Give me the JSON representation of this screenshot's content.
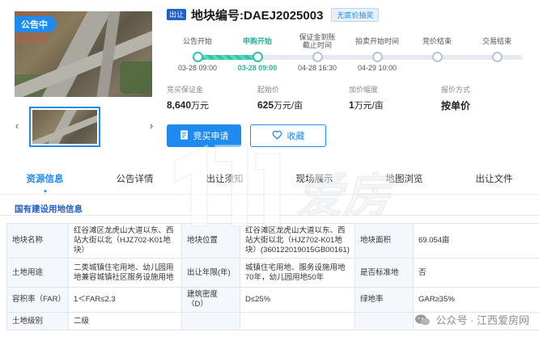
{
  "gallery": {
    "badge": "公告中",
    "prev_arrow": "‹",
    "next_arrow": "›"
  },
  "header": {
    "status_tag": "出让",
    "title": "地块编号:DAEJ2025003",
    "reserve_tag": "无底价抽奖"
  },
  "timeline": {
    "progress_fraction": 0.25,
    "steps": [
      {
        "label": "公告开始",
        "date": "03-28 09:00",
        "state": "done"
      },
      {
        "label": "申购开始",
        "date": "03-28 09:00",
        "state": "current"
      },
      {
        "label": "保证金到账\n截止时间",
        "date": "04-28 16:30",
        "state": "pending"
      },
      {
        "label": "拍卖开始时间",
        "date": "04-29 10:00",
        "state": "pending"
      },
      {
        "label": "竞价结束",
        "date": "",
        "state": "pending"
      },
      {
        "label": "交易结束",
        "date": "",
        "state": "pending"
      }
    ]
  },
  "stats": {
    "deposit_label": "竞买保证金",
    "deposit_value": "8,640",
    "deposit_unit": "万元",
    "start_price_label": "起始价",
    "start_price_value": "625",
    "start_price_unit": "万元/亩",
    "increment_label": "加价幅度",
    "increment_value": "1",
    "increment_unit": "万元/亩",
    "quote_label": "报价方式",
    "quote_value": "按单价"
  },
  "actions": {
    "apply_label": "竞买申请",
    "favorite_label": "收藏"
  },
  "tabs": [
    "资源信息",
    "公告详情",
    "出让须知",
    "现场展示",
    "地图浏览",
    "出让文件"
  ],
  "section": {
    "title": "国有建设用地信息"
  },
  "table": {
    "rows": [
      [
        "地块名称",
        "红谷滩区龙虎山大道以东、西站大街以北（HJZ702-K01地块）",
        "地块位置",
        "红谷滩区龙虎山大道以东、西站大街以北（HJZ702-K01地块）(360122019015GB00161)",
        "地块面积",
        "69.054亩"
      ],
      [
        "土地用途",
        "二类城镇住宅用地、幼儿园用地兼容城镇社区服务设施用地",
        "出让年限(年)",
        "城镇住宅用地、服务设施用地70年，幼儿园用地50年",
        "是否标准地",
        "否"
      ],
      [
        "容积率（FAR）",
        "1＜FAR≤2.3",
        "建筑密度（D）",
        "D≤25%",
        "绿地率",
        "GAR≥35%"
      ],
      [
        "土地级别",
        "二级",
        "",
        "",
        "",
        ""
      ]
    ]
  },
  "watermark": {
    "logo_text": "爱房",
    "wechat_text": "公众号 · 江西爱房网"
  },
  "colors": {
    "accent": "#1f8bf0",
    "progress": "#2fc3a8",
    "title_blue": "#1f5fc9"
  }
}
